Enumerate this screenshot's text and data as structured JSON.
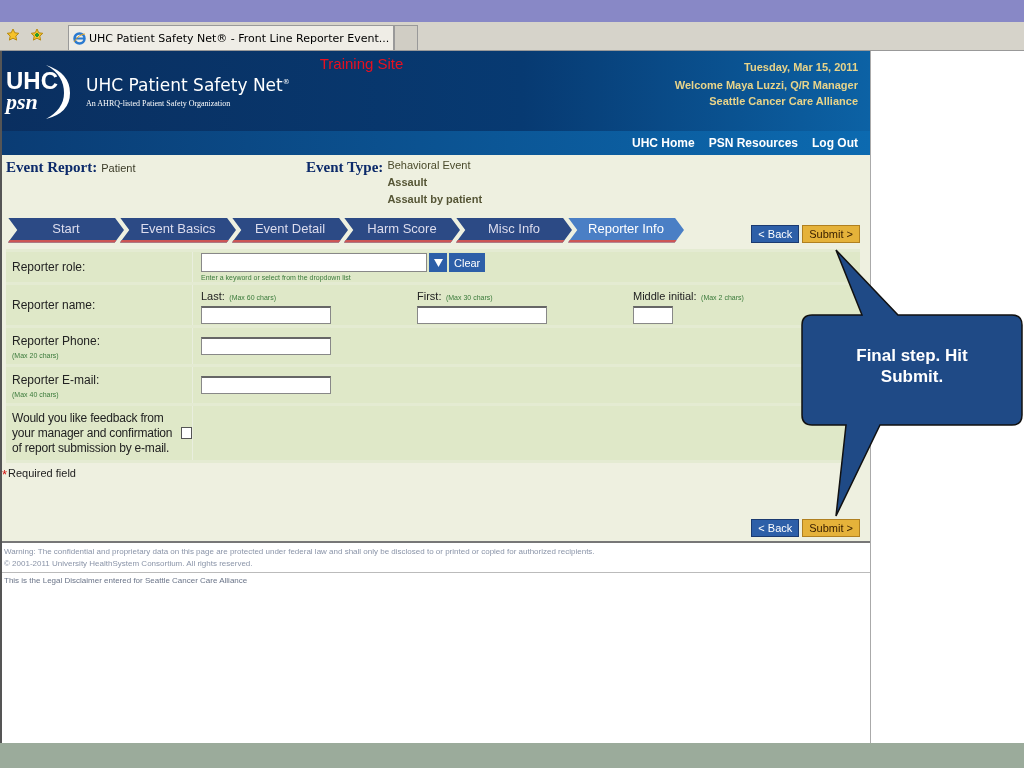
{
  "browser": {
    "tab_title": "UHC Patient Safety Net® - Front Line Reporter Event..."
  },
  "header": {
    "logo_top": "UHC",
    "logo_bottom": "psn",
    "title": "UHC Patient Safety Net",
    "title_mark": "®",
    "subtitle": "An AHRQ-listed Patient Safety Organization",
    "site_label": "Training Site",
    "date": "Tuesday, Mar 15, 2011",
    "welcome": "Welcome Maya Luzzi, Q/R Manager",
    "organization": "Seattle Cancer Care Alliance",
    "nav": [
      "UHC Home",
      "PSN Resources",
      "Log Out"
    ]
  },
  "event": {
    "report_label": "Event Report:",
    "report_value": "Patient",
    "type_label": "Event Type:",
    "type_values": [
      "Behavioral Event",
      "Assault",
      "Assault by patient"
    ]
  },
  "steps": [
    {
      "label": "Start",
      "selected": false
    },
    {
      "label": "Event Basics",
      "selected": false
    },
    {
      "label": "Event Detail",
      "selected": false
    },
    {
      "label": "Harm Score",
      "selected": false
    },
    {
      "label": "Misc Info",
      "selected": false
    },
    {
      "label": "Reporter Info",
      "selected": true
    }
  ],
  "top_buttons": {
    "back": "< Back",
    "submit": "Submit >"
  },
  "bottom_buttons": {
    "back": "< Back",
    "submit": "Submit >"
  },
  "form": {
    "role_label": "Reporter role:",
    "role_hint": "Enter a keyword or select from the dropdown list",
    "clear": "Clear",
    "name_label": "Reporter name:",
    "name_parts": [
      {
        "label": "Last:",
        "hint": "(Max 60 chars)"
      },
      {
        "label": "First:",
        "hint": "(Max 30 chars)"
      },
      {
        "label": "Middle initial:",
        "hint": "(Max 2 chars)"
      }
    ],
    "phone_label": "Reporter Phone:",
    "phone_hint": "(Max 20 chars)",
    "email_label": "Reporter E-mail:",
    "email_hint": "(Max 40 chars)",
    "feedback_label": "Would you like feedback from your manager and confirmation of report submission by e-mail.",
    "feedback_checked": false
  },
  "required": {
    "mark": "*",
    "text": "Required field"
  },
  "footer": {
    "warning": "Warning: The confidential and proprietary data on this page are protected under federal law and shall only be disclosed to or printed or copied for authorized recipients.",
    "copyright": "© 2001-2011 University HealthSystem Consortium. All rights reserved.",
    "disclaimer": "This is the Legal Disclaimer entered for Seattle Cancer Care Alliance"
  },
  "callout": {
    "text": "Final step. Hit Submit."
  }
}
